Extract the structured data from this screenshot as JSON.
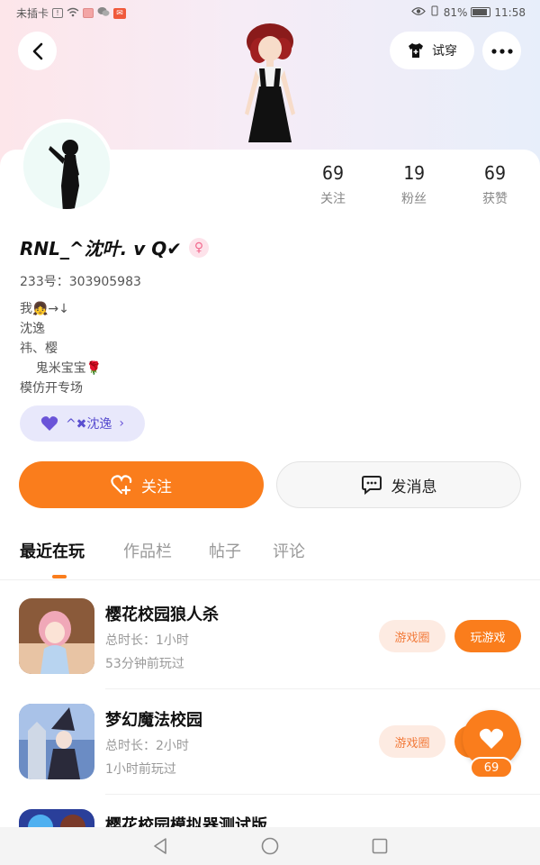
{
  "status_bar": {
    "carrier": "未插卡",
    "battery": "81%",
    "time": "11:58"
  },
  "header": {
    "try_on_label": "试穿"
  },
  "stats": [
    {
      "value": "69",
      "label": "关注"
    },
    {
      "value": "19",
      "label": "粉丝"
    },
    {
      "value": "69",
      "label": "获赞"
    }
  ],
  "profile": {
    "nickname": "RNL_^沈叶. v Q✔",
    "uid": "233号：303905983",
    "bio_lines": [
      "我👧→↓",
      "沈逸",
      "祎、樱",
      "    鬼米宝宝🌹",
      "模仿开专场"
    ],
    "tag": "^✖沈逸"
  },
  "actions": {
    "follow": "关注",
    "message": "发消息"
  },
  "tabs": [
    "最近在玩",
    "作品栏",
    "帖子",
    "评论"
  ],
  "games": [
    {
      "title": "樱花校园狼人杀",
      "duration": "总时长：1小时",
      "last_played": "53分钟前玩过",
      "circle": "游戏圈",
      "play": "玩游戏"
    },
    {
      "title": "梦幻魔法校园",
      "duration": "总时长：2小时",
      "last_played": "1小时前玩过",
      "circle": "游戏圈",
      "play": "玩游戏"
    },
    {
      "title": "樱花校园模拟器测试版"
    }
  ],
  "like_fab": {
    "count": "69"
  },
  "colors": {
    "accent": "#fa7d1c",
    "tag_bg": "#e8e8fb",
    "tag_text": "#5a4fd0"
  }
}
